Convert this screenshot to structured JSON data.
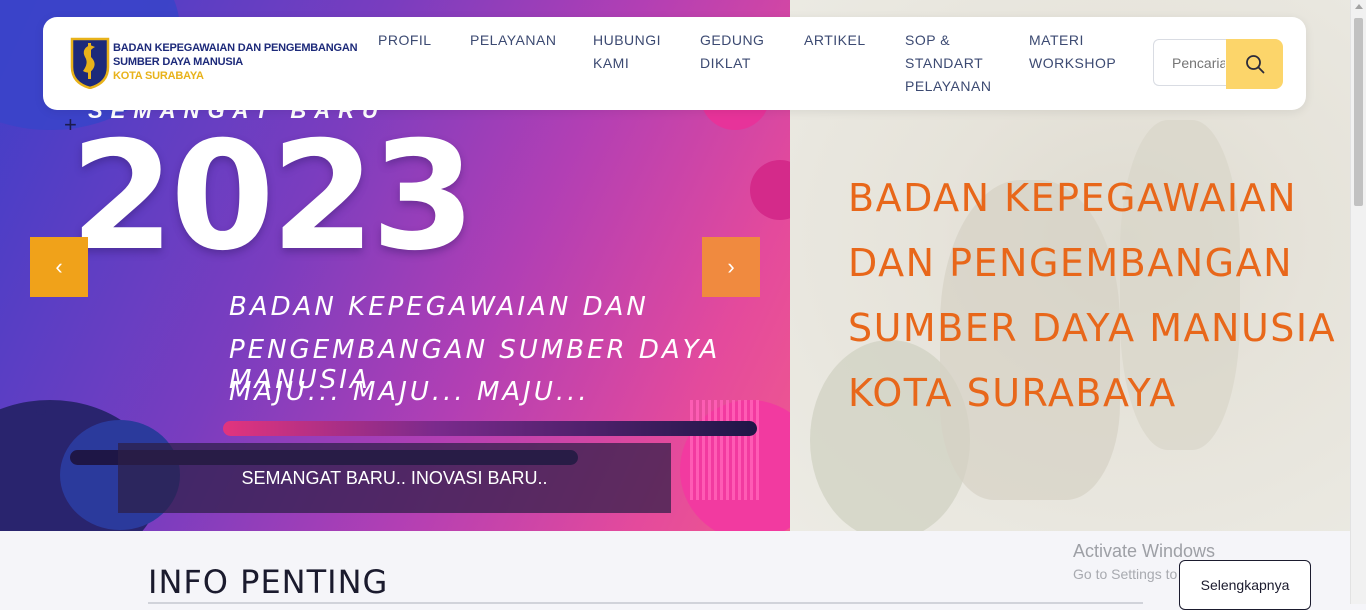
{
  "colors": {
    "accent_orange": "#e8671a",
    "search_button": "#fcd56a",
    "nav_text": "#3c4a72",
    "brand_blue": "#1d2a7a",
    "brand_gold": "#e8b21a"
  },
  "brand": {
    "line1": "BADAN KEPEGAWAIAN DAN PENGEMBANGAN",
    "line2": "SUMBER DAYA MANUSIA",
    "line3": "KOTA SURABAYA"
  },
  "nav": {
    "items": [
      {
        "label": "PROFIL"
      },
      {
        "label": "PELAYANAN"
      },
      {
        "label": "HUBUNGI KAMI"
      },
      {
        "label": "GEDUNG DIKLAT"
      },
      {
        "label": "ARTIKEL"
      },
      {
        "label": "SOP & STANDART PELAYANAN"
      },
      {
        "label": "MATERI WORKSHOP"
      }
    ],
    "search_placeholder": "Pencarian",
    "search_icon": "search-icon"
  },
  "slider": {
    "slide_tagline": "SEMANGAT BARU",
    "slide_year": "2023",
    "slide_lines": [
      "BADAN KEPEGAWAIAN DAN",
      "PENGEMBANGAN SUMBER DAYA MANUSIA",
      "MAJU... MAJU... MAJU..."
    ],
    "caption": "SEMANGAT BARU.. INOVASI BARU..",
    "prev_icon": "chevron-left-icon",
    "next_icon": "chevron-right-icon",
    "prev_symbol": "‹",
    "next_symbol": "›"
  },
  "hero_right": {
    "title_lines": [
      "BADAN KEPEGAWAIAN",
      "DAN PENGEMBANGAN",
      "SUMBER DAYA MANUSIA",
      "KOTA SURABAYA"
    ]
  },
  "info": {
    "title": "INFO PENTING",
    "more_label": "Selengkapnya"
  },
  "watermark": {
    "line1": "Activate Windows",
    "line2": "Go to Settings to activate Windows."
  }
}
